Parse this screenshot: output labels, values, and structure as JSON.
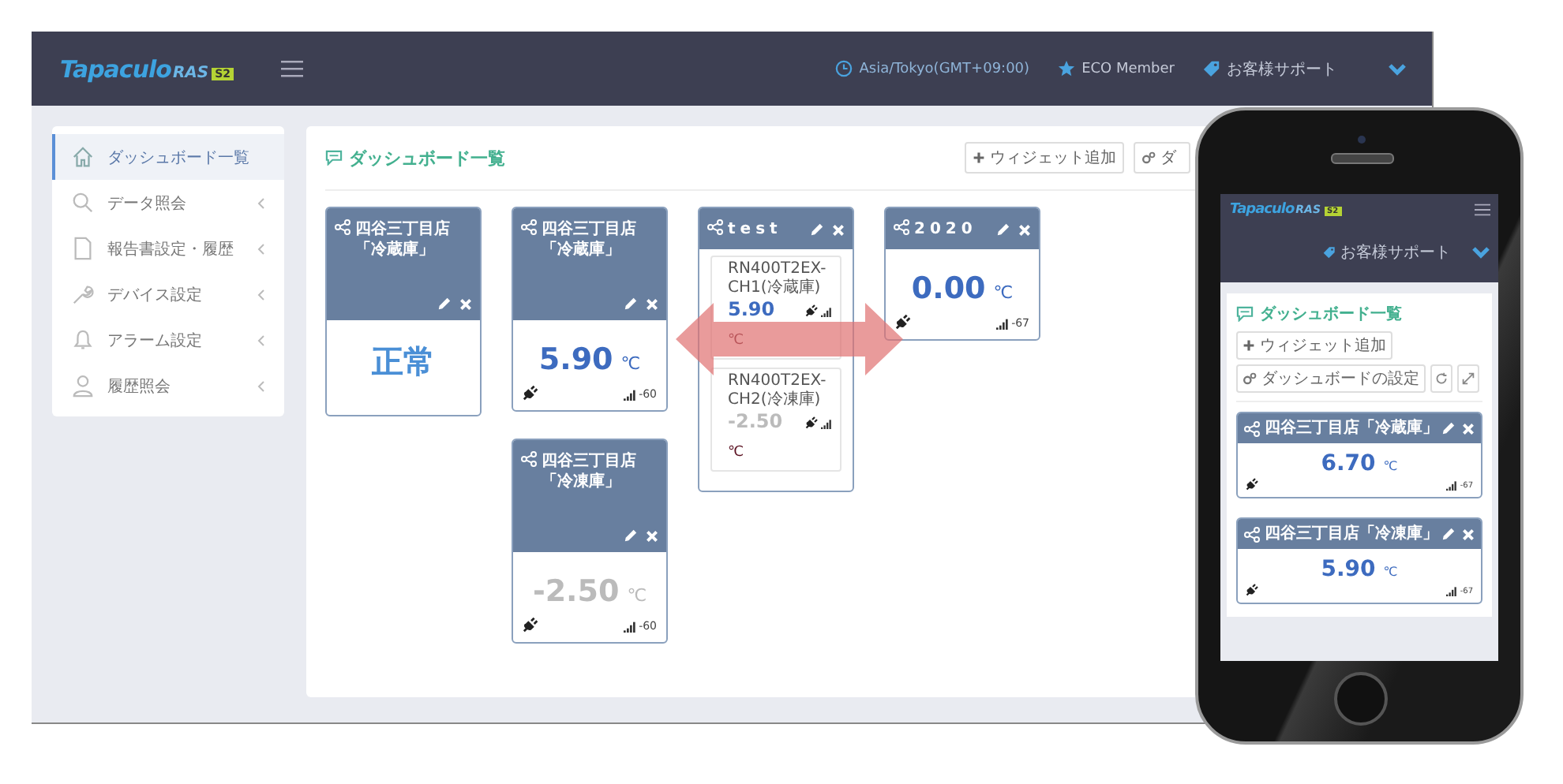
{
  "desktop": {
    "topbar": {
      "logo": {
        "name": "Tapaculo",
        "suffix": "RAS",
        "badge": "S2"
      },
      "timezone": "Asia/Tokyo(GMT+09:00)",
      "member": "ECO Member",
      "support": "お客様サポート"
    },
    "sidebar": {
      "items": [
        {
          "label": "ダッシュボード一覧",
          "selected": true,
          "submenu": false
        },
        {
          "label": "データ照会",
          "selected": false,
          "submenu": true
        },
        {
          "label": "報告書設定・履歴",
          "selected": false,
          "submenu": true
        },
        {
          "label": "デバイス設定",
          "selected": false,
          "submenu": true
        },
        {
          "label": "アラーム設定",
          "selected": false,
          "submenu": true
        },
        {
          "label": "履歴照会",
          "selected": false,
          "submenu": true
        }
      ]
    },
    "main": {
      "title": "ダッシュボード一覧",
      "buttons": [
        {
          "label": "ウィジェット追加"
        },
        {
          "label": "ダ"
        }
      ],
      "columns": [
        [
          {
            "kind": "status",
            "title": "四谷三丁目店「冷蔵庫」",
            "status": "正常"
          }
        ],
        [
          {
            "kind": "value",
            "title": "四谷三丁目店「冷蔵庫」",
            "value": "5.90",
            "unit": "℃",
            "reading": "-60",
            "stale": false
          },
          {
            "kind": "value",
            "title": "四谷三丁目店「冷凍庫」",
            "value": "-2.50",
            "unit": "℃",
            "reading": "-60",
            "stale": true
          }
        ],
        [
          {
            "kind": "group",
            "title": "test",
            "channels": [
              {
                "name": "RN400T2EX-CH1(冷蔵庫)",
                "value": "5.90",
                "unit": "℃",
                "stale": false
              },
              {
                "name": "RN400T2EX-CH2(冷凍庫)",
                "value": "-2.50",
                "unit": "℃",
                "stale": true
              }
            ]
          }
        ],
        [
          {
            "kind": "value",
            "title": "2020",
            "value": "0.00",
            "unit": "℃",
            "reading": "-67",
            "stale": false
          }
        ]
      ]
    }
  },
  "phone": {
    "topbar": {
      "logo": {
        "name": "Tapaculo",
        "suffix": "RAS",
        "badge": "S2"
      },
      "support": "お客様サポート"
    },
    "title": "ダッシュボード一覧",
    "buttons": [
      {
        "label": "ウィジェット追加"
      },
      {
        "label": "ダッシュボードの設定"
      }
    ],
    "widgets": [
      {
        "kind": "value",
        "title": "四谷三丁目店「冷蔵庫」",
        "value": "6.70",
        "unit": "℃",
        "reading": "-67",
        "stale": false
      },
      {
        "kind": "value",
        "title": "四谷三丁目店「冷凍庫」",
        "value": "5.90",
        "unit": "℃",
        "reading": "-67",
        "stale": false
      }
    ]
  }
}
